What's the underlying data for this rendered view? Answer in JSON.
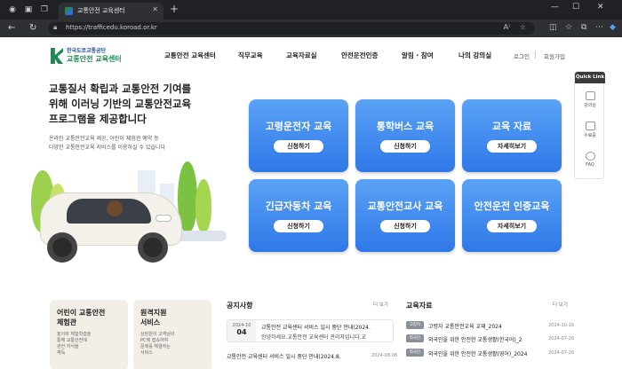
{
  "browser": {
    "tab_title": "교통안전 교육센터",
    "url": "https://trafficedu.koroad.or.kr"
  },
  "site": {
    "logo_small": "한국도로교통공단",
    "logo_big": "교통안전 교육센터",
    "nav": [
      "교통안전 교육센터",
      "직무교육",
      "교육자료실",
      "안전운전인증",
      "알림 · 참여",
      "나의 강의실"
    ],
    "login": "로그인",
    "signup": "회원가입"
  },
  "hero": {
    "title_lines": [
      "교통질서 확립과 교통안전 기여를",
      "위해 이러닝 기반의 교통안전교육",
      "프로그램을 제공합니다"
    ],
    "sub_lines": [
      "온라인 교통안전교육 제공, 어린이 체험관 예약 등",
      "다양한 교통안전교육 서비스를 이용하실 수 있습니다"
    ]
  },
  "cards": [
    {
      "title": "고령운전자 교육",
      "button": "신청하기"
    },
    {
      "title": "통학버스 교육",
      "button": "신청하기"
    },
    {
      "title": "교육 자료",
      "button": "자세히보기"
    },
    {
      "title": "긴급자동차 교육",
      "button": "신청하기"
    },
    {
      "title": "교통안전교사 교육",
      "button": "신청하기"
    },
    {
      "title": "안전운전 인증교육",
      "button": "자세히보기"
    }
  ],
  "quick_link": {
    "header": "Quick Link",
    "items": [
      "강의실",
      "수료증",
      "FAQ"
    ]
  },
  "promos": [
    {
      "title_lines": [
        "어린이 교통안전",
        "체험관"
      ],
      "desc_lines": [
        "놀이와 체험학습을",
        "통해 교통안전에",
        "관한 지식을",
        "체득"
      ]
    },
    {
      "title_lines": [
        "원격지원",
        "서비스"
      ],
      "desc_lines": [
        "상담원이 고객님의",
        "PC에 접속하여",
        "문제를 해결하는",
        "서비스"
      ]
    }
  ],
  "notice": {
    "title": "공지사항",
    "more": "더 보기",
    "featured": {
      "year_month": "2024-10",
      "day": "04",
      "title": "교통안전 교육센터 서비스 일시 중단 안내(2024.",
      "desc": "안녕하세요.교통안전 교육센터 관리자입니다.교"
    },
    "rows": [
      {
        "title": "교통안전 교육센터 서비스 일시 중단 안내(2024.8.",
        "date": "2024-08-08"
      }
    ]
  },
  "materials": {
    "title": "교육자료",
    "more": "더 보기",
    "rows": [
      {
        "badge": "고령자",
        "title": "고령자 교통안전교육 교재_2024",
        "date": "2024-10-16"
      },
      {
        "badge": "외국인",
        "title": "외국인을 위한 안전한 교통생활(한국어)_2",
        "date": "2024-07-26"
      },
      {
        "badge": "외국인",
        "title": "외국인을 위한 안전한 교통생활(영어)_2024",
        "date": "2024-07-26"
      }
    ]
  },
  "colors": {
    "card_blue": "#2f78e8",
    "brand_green": "#1f8a57",
    "brand_blue": "#1f4f9e"
  }
}
